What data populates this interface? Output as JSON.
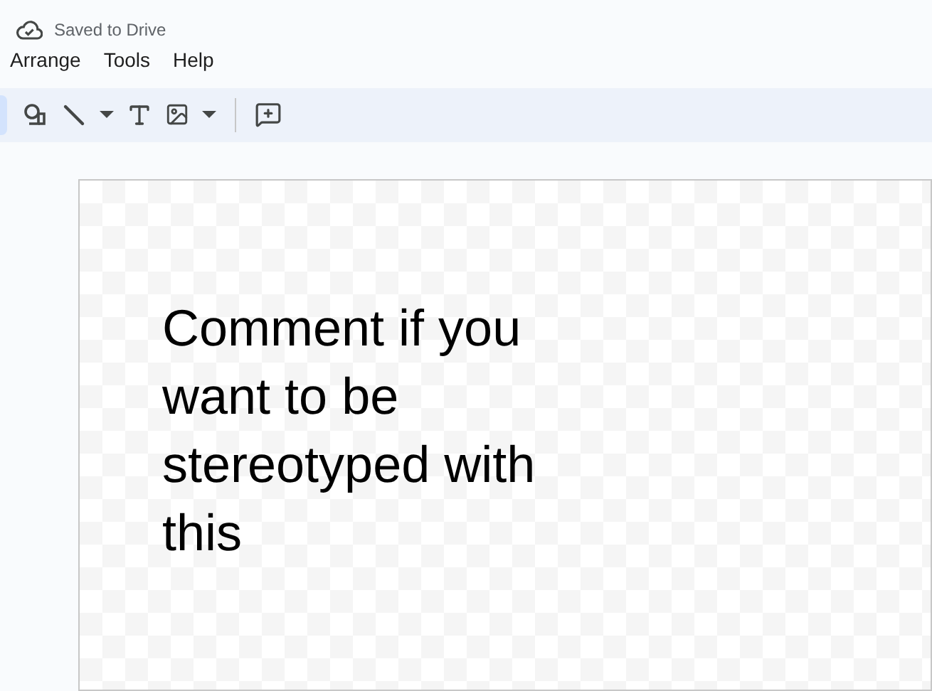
{
  "status": "Saved to Drive",
  "menu": [
    {
      "label": "Arrange"
    },
    {
      "label": "Tools"
    },
    {
      "label": "Help"
    }
  ],
  "toolbar": [
    {
      "kind": "shape"
    },
    {
      "kind": "line"
    },
    {
      "kind": "dropdown"
    },
    {
      "kind": "textbox"
    },
    {
      "kind": "image"
    },
    {
      "kind": "dropdown"
    },
    {
      "kind": "divider"
    },
    {
      "kind": "comment"
    }
  ],
  "canvas": {
    "text": "Comment if you want to be stereotyped with this"
  }
}
